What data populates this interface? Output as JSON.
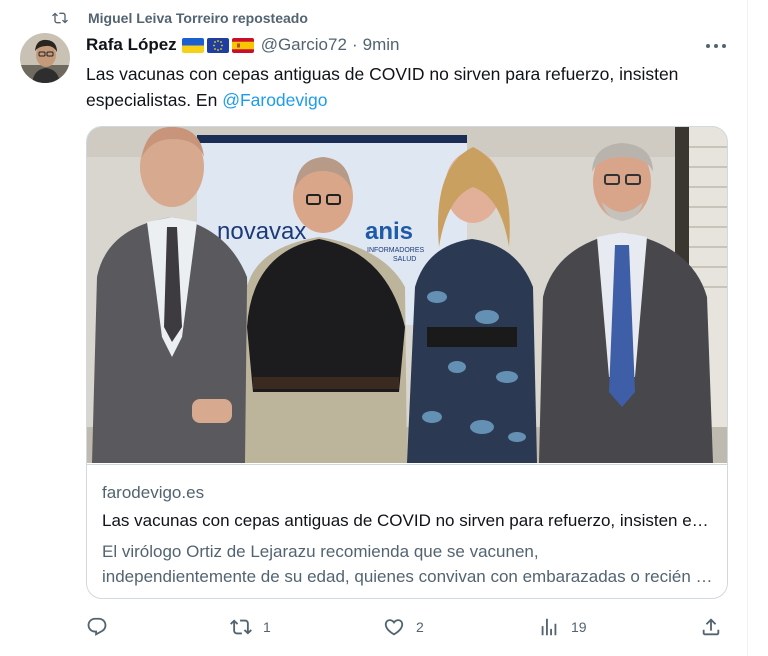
{
  "repost": {
    "label": "Miguel Leiva Torreiro reposteado",
    "icon": "repost-icon"
  },
  "author": {
    "name": "Rafa López",
    "flags": [
      "ukraine-flag",
      "eu-flag",
      "spain-flag"
    ],
    "handle": "@Garcio72",
    "separator": "·",
    "time": "9min"
  },
  "tweet": {
    "text": "Las vacunas con cepas antiguas de COVID no sirven para refuerzo, insisten especialistas. En ",
    "mention": "@Farodevigo"
  },
  "card": {
    "image_text": {
      "brand1": "novavax",
      "brand2": "anis",
      "brand2_sub1": "INFORMADORES",
      "brand2_sub2": "SALUD"
    },
    "domain": "farodevigo.es",
    "title": "Las vacunas con cepas antiguas de COVID no sirven para refuerzo, insisten especialistas",
    "description_line1": "El virólogo Ortiz de Lejarazu recomienda que se vacunen,",
    "description_line2": "independientemente de su edad, quienes convivan con embarazadas o recién nacidos"
  },
  "actions": {
    "reply": {
      "icon": "reply-icon",
      "count": ""
    },
    "retweet": {
      "icon": "retweet-icon",
      "count": "1"
    },
    "like": {
      "icon": "heart-icon",
      "count": "2"
    },
    "views": {
      "icon": "analytics-icon",
      "count": "19"
    },
    "share": {
      "icon": "share-icon",
      "count": ""
    }
  },
  "colors": {
    "accent": "#1d9bf0",
    "secondary_text": "#536471",
    "primary_text": "#0f1419",
    "border": "#cfd9de"
  }
}
